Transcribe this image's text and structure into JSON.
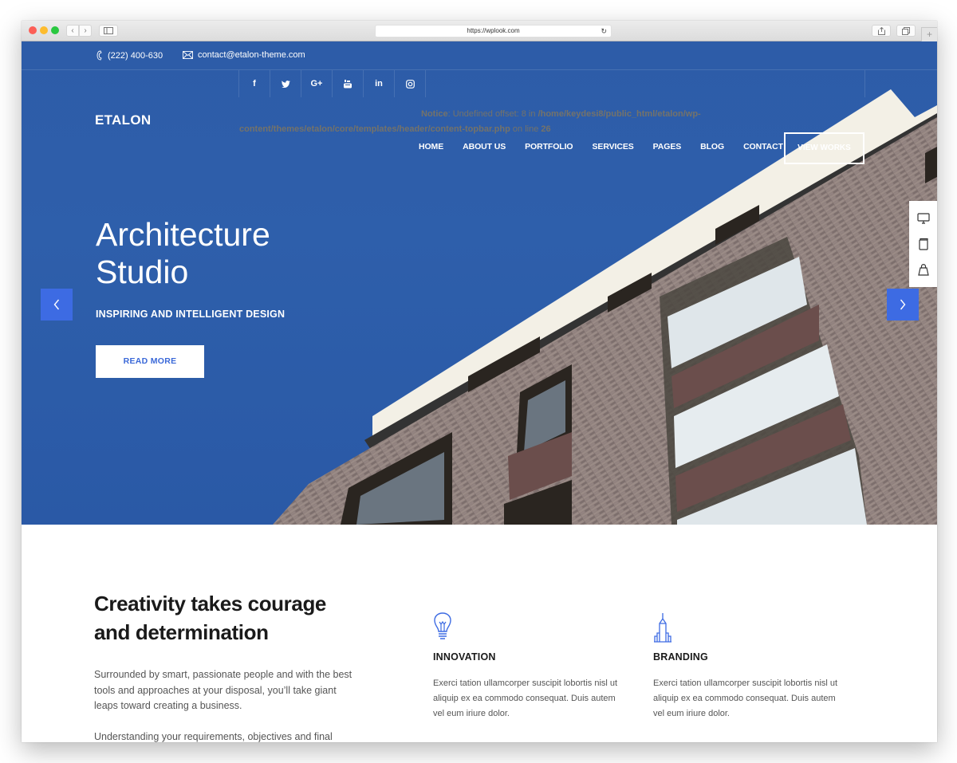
{
  "browser": {
    "url": "https://wplook.com",
    "buttons": {
      "back": "back-icon",
      "forward": "forward-icon",
      "sidebar": "sidebar-icon",
      "reload": "reload-icon",
      "share": "share-icon",
      "tabs": "tabs-icon",
      "new_tab": "+"
    }
  },
  "topbar": {
    "phone": "(222) 400-630",
    "email": "contact@etalon-theme.com",
    "social": [
      {
        "name": "facebook",
        "glyph": "f"
      },
      {
        "name": "twitter",
        "glyph": "t"
      },
      {
        "name": "google-plus",
        "glyph": "G+"
      },
      {
        "name": "youtube",
        "glyph": "You"
      },
      {
        "name": "linkedin",
        "glyph": "in"
      },
      {
        "name": "instagram",
        "glyph": "ig"
      }
    ]
  },
  "notice": {
    "label": "Notice",
    "message": ": Undefined offset: 8 in ",
    "path_part1": "/home/keydesi8/public_html/etalon/wp-",
    "path_part2": "content/themes/etalon/core/templates/header/content-topbar.php",
    "line_text": " on line ",
    "line_number": "26"
  },
  "header": {
    "logo": "ETALON",
    "nav": [
      "HOME",
      "ABOUT US",
      "PORTFOLIO",
      "SERVICES",
      "PAGES",
      "BLOG",
      "CONTACT"
    ],
    "cta": "VIEW WORKS"
  },
  "hero": {
    "title_line1": "Architecture",
    "title_line2": "Studio",
    "subtitle": "INSPIRING AND INTELLIGENT DESIGN",
    "button": "READ MORE",
    "prev": "previous-slide",
    "next": "next-slide"
  },
  "side_panel": [
    "monitor-icon",
    "book-icon",
    "shopping-bag-icon"
  ],
  "content": {
    "headline_line1": "Creativity takes courage",
    "headline_line2": "and determination",
    "paragraph1": "Surrounded by smart, passionate people and with the best tools and approaches at your disposal, you’ll take giant leaps toward creating a business.",
    "paragraph2": "Understanding your requirements, objectives and final",
    "features": [
      {
        "icon": "lightbulb-icon",
        "title": "INNOVATION",
        "description": "Exerci tation ullamcorper suscipit lobortis nisl ut aliquip ex ea commodo consequat. Duis autem vel eum iriure dolor."
      },
      {
        "icon": "skyscraper-icon",
        "title": "BRANDING",
        "description": "Exerci tation ullamcorper suscipit lobortis nisl ut aliquip ex ea commodo consequat. Duis autem vel eum iriure dolor."
      }
    ]
  },
  "colors": {
    "hero_blue": "#2d5ca8",
    "accent": "#3d6be3",
    "notice_text": "#8c7a55",
    "heading": "#1a1a1a",
    "body_text": "#555555"
  }
}
